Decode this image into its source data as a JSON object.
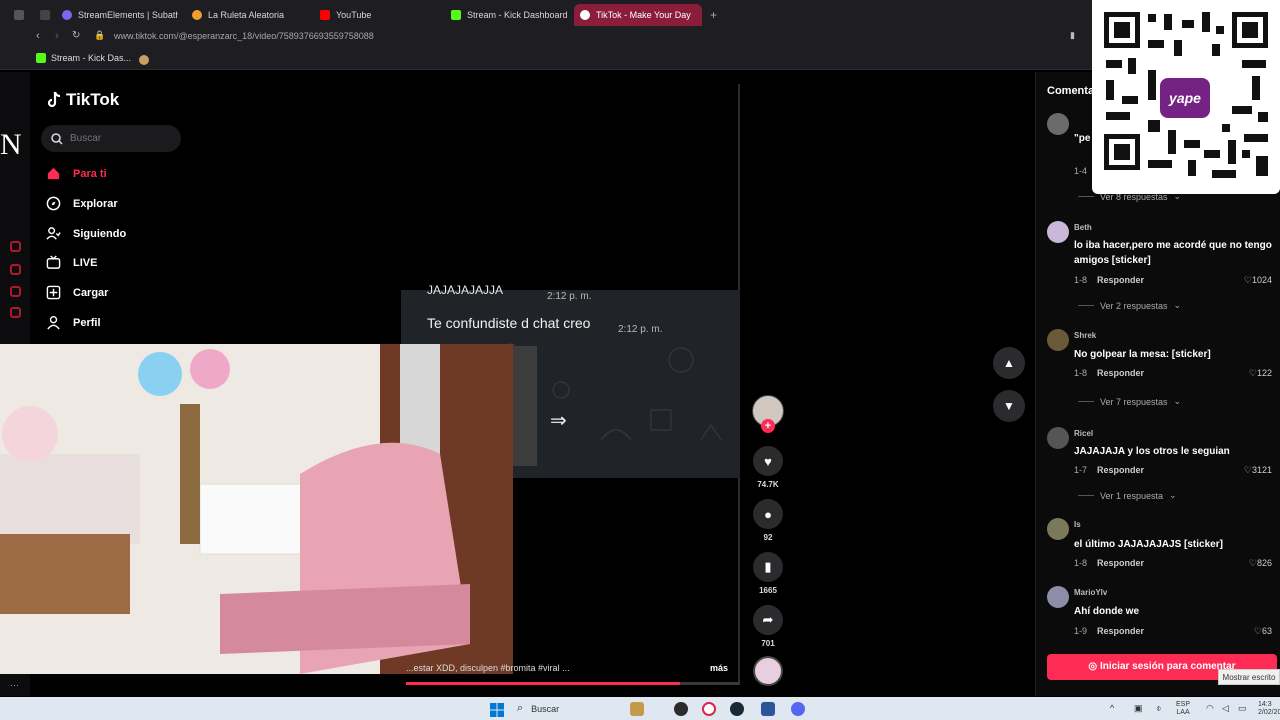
{
  "browser": {
    "tabs": [
      {
        "label": "StreamElements | Subatho",
        "color": "#7b68ee"
      },
      {
        "label": "La Ruleta Aleatoria",
        "color": "#f0a030"
      },
      {
        "label": "YouTube",
        "color": "#ff0000"
      },
      {
        "label": "Stream - Kick Dashboard",
        "color": "#53fc18"
      },
      {
        "label": "TikTok - Make Your Day",
        "color": "#ffffff"
      }
    ],
    "url": "www.tiktok.com/@esperanzarc_18/video/7589376693559758088",
    "bookmarks": [
      {
        "label": "Stream - Kick Das..."
      }
    ]
  },
  "sidebar": {
    "logo": "TikTok",
    "search_placeholder": "Buscar",
    "nav": [
      {
        "label": "Para ti",
        "icon": "home-icon",
        "active": true
      },
      {
        "label": "Explorar",
        "icon": "compass-icon"
      },
      {
        "label": "Siguiendo",
        "icon": "following-icon"
      },
      {
        "label": "LIVE",
        "icon": "live-icon"
      },
      {
        "label": "Cargar",
        "icon": "upload-icon"
      },
      {
        "label": "Perfil",
        "icon": "profile-icon"
      }
    ]
  },
  "video": {
    "chat_line_top": "JAJAJAJAJJA",
    "chat_time_top": "2:12 p. m.",
    "chat_message": "Te confundiste d chat creo",
    "chat_time": "2:12 p. m.",
    "caption": "...estar XDD, disculpen #bromita #viral ...",
    "more_label": "más",
    "progress": 0.82
  },
  "actions": {
    "likes": "74.7K",
    "comments": "92",
    "saves": "1665",
    "shares": "701"
  },
  "comments": {
    "title": "Comenta",
    "items": [
      {
        "user": "Beth",
        "text": "lo iba hacer,pero me acordé que no tengo amigos [sticker]",
        "meta": "1-8",
        "reply": "Responder",
        "likes": "1024",
        "more": "Ver 2 respuestas"
      },
      {
        "user": "Shrek",
        "text": "No golpear la mesa: [sticker]",
        "meta": "1-8",
        "reply": "Responder",
        "likes": "122",
        "more": "Ver 7 respuestas"
      },
      {
        "user": "Ricel",
        "text": "JAJAJAJA y los otros le seguian",
        "meta": "1-7",
        "reply": "Responder",
        "likes": "3121",
        "more": "Ver 1 respuesta"
      },
      {
        "user": "Is",
        "text": "el último JAJAJAJAJS [sticker]",
        "meta": "1-8",
        "reply": "Responder",
        "likes": "826",
        "more": ""
      },
      {
        "user": "MarioYlv",
        "text": "Ahí donde we",
        "meta": "1-9",
        "reply": "Responder",
        "likes": "63",
        "more": ""
      }
    ],
    "partial_top": {
      "text": "\"pe",
      "meta": "1-4",
      "more": "Ver 8 respuestas"
    },
    "login_label": "Iniciar sesión para comentar"
  },
  "qr": {
    "brand": "yape"
  },
  "overlay_letter": "N",
  "tooltip": "Mostrar escrito",
  "taskbar": {
    "search_label": "Buscar",
    "lang": "ESP",
    "lang2": "LAA",
    "time": "14:3",
    "date": "2/02/20"
  }
}
